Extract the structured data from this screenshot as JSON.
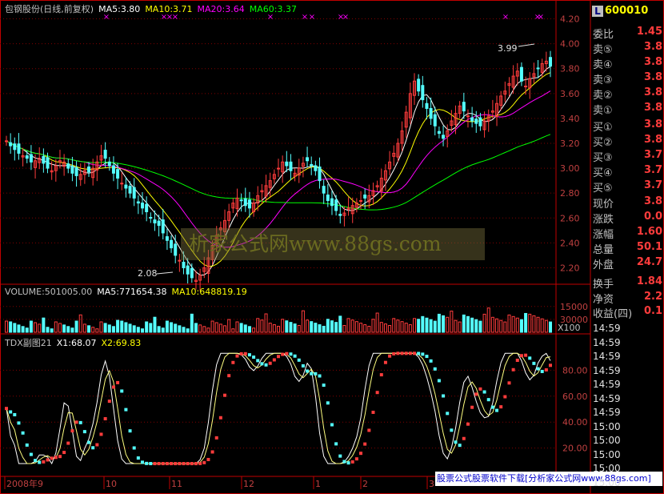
{
  "header": {
    "stock_name": "包钢股份(日线,前复权)",
    "ma5": "MA5:3.80",
    "ma10": "MA10:3.71",
    "ma20": "MA20:3.64",
    "ma60": "MA60:3.37"
  },
  "volume_header": {
    "label": "VOLUME:501005.00",
    "ma5": "MA5:771654.38",
    "ma10": "MA10:648819.19"
  },
  "indicator_header": {
    "label": "TDX副图21",
    "x1": "X1:68.07",
    "x2": "X2:69.83"
  },
  "annotations": {
    "high": "3.99",
    "low": "2.08",
    "volume_unit": "X100"
  },
  "date_labels": [
    "2008年9",
    "10",
    "11",
    "12",
    "1",
    "2",
    "3"
  ],
  "price_ticks": [
    "4.20",
    "4.00",
    "3.80",
    "3.60",
    "3.40",
    "3.20",
    "3.00",
    "2.80",
    "2.60",
    "2.40",
    "2.20"
  ],
  "volume_ticks": [
    "30000",
    "15000"
  ],
  "indicator_ticks": [
    "80.00",
    "60.00",
    "40.00",
    "20.00"
  ],
  "right_panel": {
    "code_badge": "L",
    "code": "600010",
    "rows": [
      {
        "label": "委比",
        "value": "1.45"
      },
      {
        "label": "卖⑤",
        "value": "3.8"
      },
      {
        "label": "卖④",
        "value": "3.8"
      },
      {
        "label": "卖③",
        "value": "3.8"
      },
      {
        "label": "卖②",
        "value": "3.8"
      },
      {
        "label": "卖①",
        "value": "3.8"
      },
      {
        "label": "买①",
        "value": "3.8"
      },
      {
        "label": "买②",
        "value": "3.8"
      },
      {
        "label": "买③",
        "value": "3.7"
      },
      {
        "label": "买④",
        "value": "3.7"
      },
      {
        "label": "买⑤",
        "value": "3.7"
      },
      {
        "label": "现价",
        "value": "3.8"
      },
      {
        "label": "涨跌",
        "value": "0.0"
      },
      {
        "label": "涨幅",
        "value": "1.60"
      },
      {
        "label": "总量",
        "value": "50.1"
      },
      {
        "label": "外盘",
        "value": "24.7"
      },
      {
        "label": "换手",
        "value": "1.84"
      },
      {
        "label": "净资",
        "value": "2.2"
      },
      {
        "label": "收益(四)",
        "value": "0.1"
      }
    ],
    "times": [
      "14:59",
      "14:59",
      "14:59",
      "14:59",
      "14:59",
      "14:59",
      "14:59",
      "15:00",
      "15:00",
      "15:00",
      "15:00",
      "15:00"
    ]
  },
  "watermark": "析家公式网www.88gs.com",
  "footer_note": "股票公式股票软件下载[分析家公式网www.88gs.com]",
  "colors": {
    "up": "#ff3c3c",
    "down": "#54ffff",
    "ma5": "#ffffff",
    "ma10": "#ffff00",
    "ma20": "#ff00ff",
    "ma60": "#00ff00",
    "grid": "#800000",
    "axis": "#c00000"
  },
  "chart_data": [
    {
      "type": "candlestick",
      "title": "包钢股份(日线,前复权)",
      "ylim": [
        2.1,
        4.3
      ],
      "x_ticks": [
        "2008年9",
        "10",
        "11",
        "12",
        "1",
        "2",
        "3"
      ],
      "close": [
        3.22,
        3.18,
        3.15,
        3.12,
        3.1,
        3.08,
        3.05,
        3.06,
        3.08,
        3.04,
        3.0,
        2.98,
        3.02,
        3.06,
        3.05,
        3.0,
        2.96,
        2.94,
        2.95,
        2.98,
        2.97,
        3.0,
        3.05,
        3.1,
        3.08,
        3.02,
        2.96,
        2.92,
        2.88,
        2.84,
        2.8,
        2.76,
        2.72,
        2.68,
        2.65,
        2.6,
        2.56,
        2.54,
        2.48,
        2.42,
        2.36,
        2.3,
        2.26,
        2.2,
        2.15,
        2.12,
        2.1,
        2.14,
        2.2,
        2.28,
        2.38,
        2.46,
        2.52,
        2.58,
        2.65,
        2.72,
        2.76,
        2.74,
        2.7,
        2.68,
        2.72,
        2.78,
        2.82,
        2.86,
        2.9,
        2.95,
        3.0,
        3.05,
        3.02,
        2.98,
        2.96,
        3.0,
        3.04,
        3.06,
        3.02,
        2.98,
        2.9,
        2.8,
        2.74,
        2.7,
        2.66,
        2.62,
        2.64,
        2.68,
        2.7,
        2.72,
        2.74,
        2.76,
        2.78,
        2.82,
        2.86,
        2.92,
        2.98,
        3.05,
        3.12,
        3.2,
        3.3,
        3.45,
        3.6,
        3.7,
        3.62,
        3.55,
        3.48,
        3.4,
        3.34,
        3.28,
        3.24,
        3.3,
        3.38,
        3.44,
        3.5,
        3.46,
        3.42,
        3.38,
        3.36,
        3.34,
        3.38,
        3.42,
        3.46,
        3.52,
        3.58,
        3.62,
        3.68,
        3.74,
        3.78,
        3.7,
        3.66,
        3.72,
        3.76,
        3.8,
        3.84,
        3.86,
        3.82
      ],
      "series": [
        {
          "name": "MA5",
          "value": 3.8
        },
        {
          "name": "MA10",
          "value": 3.71
        },
        {
          "name": "MA20",
          "value": 3.64
        },
        {
          "name": "MA60",
          "value": 3.37
        }
      ],
      "annotations": [
        {
          "label": "3.99"
        },
        {
          "label": "2.08"
        }
      ]
    },
    {
      "type": "bar",
      "title": "VOLUME:501005.00",
      "ylim": [
        0,
        40000
      ],
      "y_ticks": [
        15000,
        30000
      ],
      "unit": "X100",
      "series": [
        {
          "name": "MA5",
          "value": 771654.38
        },
        {
          "name": "MA10",
          "value": 648819.19
        }
      ]
    },
    {
      "type": "line",
      "title": "TDX副图21",
      "ylim": [
        0,
        100
      ],
      "y_ticks": [
        20,
        40,
        60,
        80
      ],
      "series": [
        {
          "name": "X1",
          "value": 68.07
        },
        {
          "name": "X2",
          "value": 69.83
        }
      ]
    }
  ]
}
